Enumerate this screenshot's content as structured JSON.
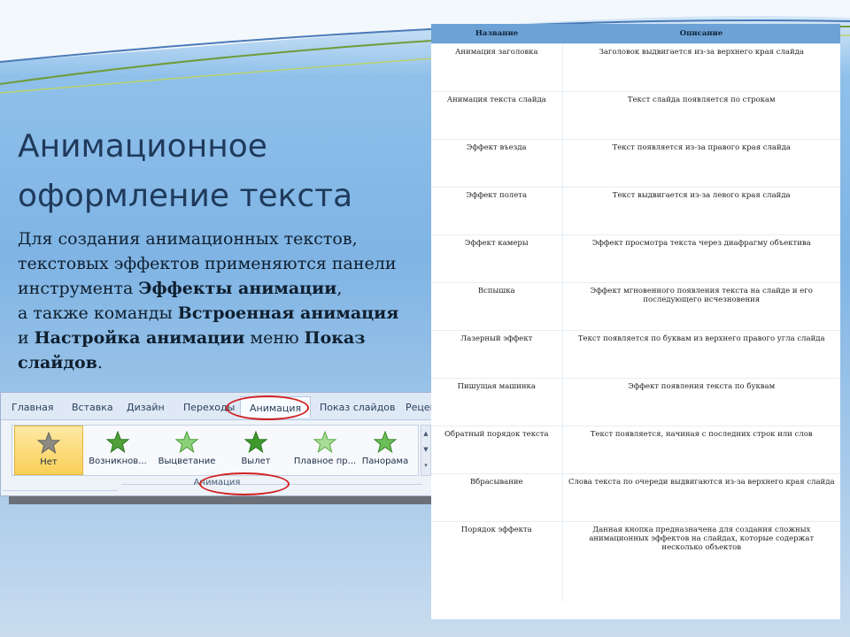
{
  "slide": {
    "title_lines": [
      "Анимационное",
      "оформление текста"
    ],
    "body": {
      "p1": "Для создания анимационных текстов, текстовых эффектов применяются панели инструмента ",
      "b1": "Эффекты анимации",
      "p2": ",",
      "p3": "а также команды ",
      "b2": "Встроенная анимация",
      "p4": "и ",
      "b3": "Настройка анимации",
      "p5": " меню ",
      "b4": "Показ слайдов",
      "p6": "."
    }
  },
  "ribbon": {
    "tabs": [
      "Главная",
      "Вставка",
      "Дизайн",
      "Переходы",
      "Анимация",
      "Показ слайдов",
      "Реценз"
    ],
    "active_tab": "Анимация",
    "items": [
      {
        "label": "Нет",
        "icon": "star-none-icon",
        "selected": true
      },
      {
        "label": "Возникнов...",
        "icon": "star-appear-icon"
      },
      {
        "label": "Выцветание",
        "icon": "star-fade-icon"
      },
      {
        "label": "Вылет",
        "icon": "star-fly-icon"
      },
      {
        "label": "Плавное пр...",
        "icon": "star-float-icon"
      },
      {
        "label": "Панорама",
        "icon": "star-pan-icon"
      }
    ],
    "group_label": "Анимация",
    "highlight_color": "#d02020"
  },
  "table": {
    "headers": [
      "Название",
      "Описание"
    ],
    "rows": [
      [
        "Анимация заголовка",
        "Заголовок выдвигается из-за верхнего края слайда"
      ],
      [
        "Анимация текста слайда",
        "Текст слайда появляется по строкам"
      ],
      [
        "Эффект въезда",
        "Текст появляется из-за правого края слайда"
      ],
      [
        "Эффект полета",
        "Текст выдвигается из-за левого края слайда"
      ],
      [
        "Эффект камеры",
        "Эффект просмотра текста через диафрагму объектива"
      ],
      [
        "Вспышка",
        "Эффект мгновенного появления текста на слайде и его последующего исчезновения"
      ],
      [
        "Лазерный эффект",
        "Текст появляется по буквам из верхнего правого угла слайда"
      ],
      [
        "Пишущая машинка",
        "Эффект появления текста по буквам"
      ],
      [
        "Обратный порядок текста",
        "Текст появляется, начиная с последних строк или слов"
      ],
      [
        "Вбрасывание",
        "Слова текста по очереди выдвигаются из-за верхнего края слайда"
      ],
      [
        "Порядок эффекта",
        "Данная кнопка предназначена для создания сложных анимационных эффектов на слайдах, которые содержат несколько объектов"
      ]
    ],
    "header_color": "#6ca2d6"
  }
}
